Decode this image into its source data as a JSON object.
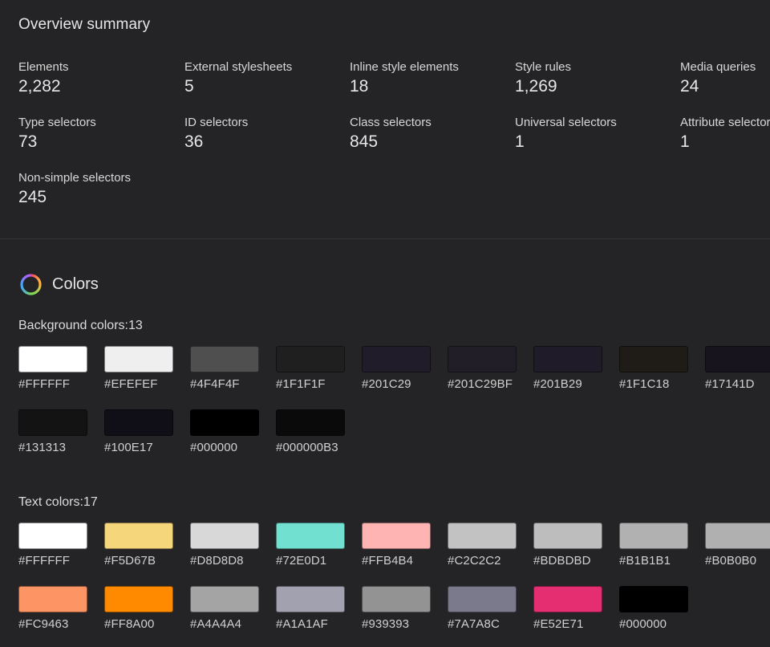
{
  "overview": {
    "title": "Overview summary",
    "stats": [
      {
        "label": "Elements",
        "value": "2,282"
      },
      {
        "label": "External stylesheets",
        "value": "5"
      },
      {
        "label": "Inline style elements",
        "value": "18"
      },
      {
        "label": "Style rules",
        "value": "1,269"
      },
      {
        "label": "Media queries",
        "value": "24"
      },
      {
        "label": "Type selectors",
        "value": "73"
      },
      {
        "label": "ID selectors",
        "value": "36"
      },
      {
        "label": "Class selectors",
        "value": "845"
      },
      {
        "label": "Universal selectors",
        "value": "1"
      },
      {
        "label": "Attribute selectors",
        "value": "1"
      },
      {
        "label": "Non-simple selectors",
        "value": "245"
      }
    ]
  },
  "colors": {
    "title": "Colors",
    "icon": "color-ring-icon",
    "background": {
      "label": "Background colors:13",
      "swatches": [
        "#FFFFFF",
        "#EFEFEF",
        "#4F4F4F",
        "#1F1F1F",
        "#201C29",
        "#201C29BF",
        "#201B29",
        "#1F1C18",
        "#17141D",
        "#131313",
        "#100E17",
        "#000000",
        "#000000B3"
      ]
    },
    "text": {
      "label": "Text colors:17",
      "swatches": [
        "#FFFFFF",
        "#F5D67B",
        "#D8D8D8",
        "#72E0D1",
        "#FFB4B4",
        "#C2C2C2",
        "#BDBDBD",
        "#B1B1B1",
        "#B0B0B0",
        "#FC9463",
        "#FF8A00",
        "#A4A4A4",
        "#A1A1AF",
        "#939393",
        "#7A7A8C",
        "#E52E71",
        "#000000"
      ]
    }
  }
}
